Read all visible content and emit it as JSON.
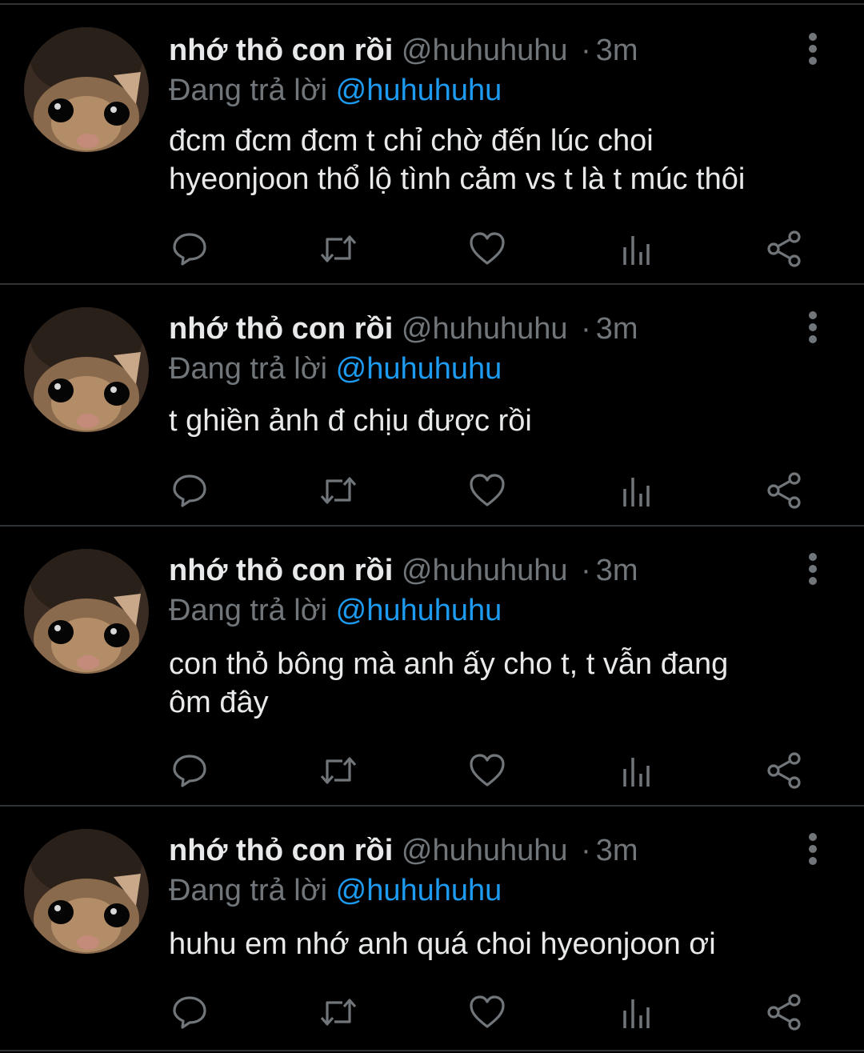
{
  "theme": {
    "background": "#000000",
    "text_primary": "#e7e9ea",
    "text_secondary": "#71767b",
    "accent": "#1d9bf0",
    "divider": "#2f3336"
  },
  "tweets": [
    {
      "display_name": "nhớ thỏ con rồi",
      "handle": "@huhuhuhu",
      "separator": "·",
      "time": "3m",
      "reply_prefix": "Đang trả lời",
      "reply_mention": "@huhuhuhu",
      "text_lines": [
        "đcm đcm đcm t chỉ chờ đến lúc choi",
        "hyeonjoon thổ lộ tình cảm vs t là t múc thôi"
      ],
      "avatar_icon": "cat-avatar",
      "action_icons": [
        "reply-icon",
        "retweet-icon",
        "like-icon",
        "analytics-icon",
        "share-icon"
      ]
    },
    {
      "display_name": "nhớ thỏ con rồi",
      "handle": "@huhuhuhu",
      "separator": "·",
      "time": "3m",
      "reply_prefix": "Đang trả lời",
      "reply_mention": "@huhuhuhu",
      "text_lines": [
        "t ghiền ảnh đ chịu được rồi"
      ],
      "avatar_icon": "cat-avatar",
      "action_icons": [
        "reply-icon",
        "retweet-icon",
        "like-icon",
        "analytics-icon",
        "share-icon"
      ]
    },
    {
      "display_name": "nhớ thỏ con rồi",
      "handle": "@huhuhuhu",
      "separator": "·",
      "time": "3m",
      "reply_prefix": "Đang trả lời",
      "reply_mention": "@huhuhuhu",
      "text_lines": [
        "con thỏ bông mà anh ấy cho t, t vẫn đang",
        "ôm đây"
      ],
      "avatar_icon": "cat-avatar",
      "action_icons": [
        "reply-icon",
        "retweet-icon",
        "like-icon",
        "analytics-icon",
        "share-icon"
      ]
    },
    {
      "display_name": "nhớ thỏ con rồi",
      "handle": "@huhuhuhu",
      "separator": "·",
      "time": "3m",
      "reply_prefix": "Đang trả lời",
      "reply_mention": "@huhuhuhu",
      "text_lines": [
        "huhu em nhớ anh quá choi hyeonjoon ơi"
      ],
      "avatar_icon": "cat-avatar",
      "action_icons": [
        "reply-icon",
        "retweet-icon",
        "like-icon",
        "analytics-icon",
        "share-icon"
      ]
    }
  ]
}
